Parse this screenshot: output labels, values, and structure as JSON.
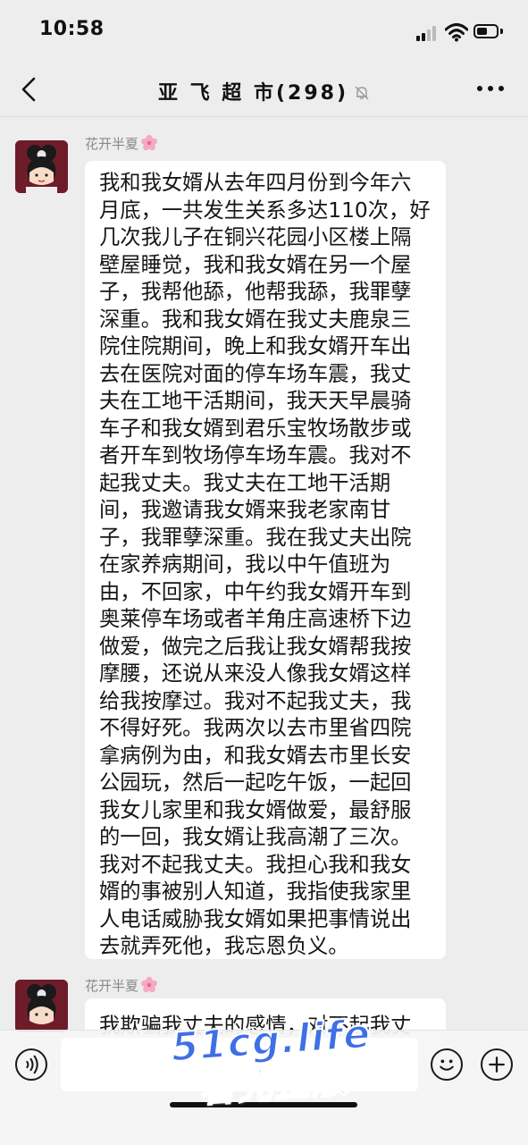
{
  "status_bar": {
    "time": "10:58"
  },
  "header": {
    "title": "亚 飞 超 市(298)"
  },
  "messages": [
    {
      "sender": "花开半夏",
      "text": "我和我女婿从去年四月份到今年六月底，一共发生关系多达110次，好几次我儿子在铜兴花园小区楼上隔壁屋睡觉，我和我女婿在另一个屋子，我帮他舔，他帮我舔，我罪孽深重。我和我女婿在我丈夫鹿泉三院住院期间，晚上和我女婿开车出去在医院对面的停车场车震，我丈夫在工地干活期间，我天天早晨骑车子和我女婿到君乐宝牧场散步或者开车到牧场停车场车震。我对不起我丈夫。我丈夫在工地干活期间，我邀请我女婿来我老家南甘子，我罪孽深重。我在我丈夫出院在家养病期间，我以中午值班为由，不回家，中午约我女婿开车到奥莱停车场或者羊角庄高速桥下边做爱，做完之后我让我女婿帮我按摩腰，还说从来没人像我女婿这样给我按摩过。我对不起我丈夫，我不得好死。我两次以去市里省四院拿病例为由，和我女婿去市里长安公园玩，然后一起吃午饭，一起回我女儿家里和我女婿做爱，最舒服的一回，我女婿让我高潮了三次。我对不起我丈夫。我担心我和我女婿的事被别人知道，我指使我家里人电话威胁我女婿如果把事情说出去就弄死他，我忘恩负义。"
    },
    {
      "sender": "花开半夏",
      "text": "我欺骗我丈夫的感情，对不起我丈"
    }
  ],
  "watermark": {
    "line1": "51cg.life",
    "line2": "看完整版"
  },
  "icons": {
    "back": "chevron-left-icon",
    "mute": "bell-slash-icon",
    "more": "ellipsis-icon",
    "voice": "voice-icon",
    "emoji": "smiley-icon",
    "plus": "plus-icon",
    "flower": "cherry-blossom-icon"
  },
  "colors": {
    "background": "#ededed",
    "bubble": "#ffffff",
    "watermark": "#3f6fe6"
  }
}
